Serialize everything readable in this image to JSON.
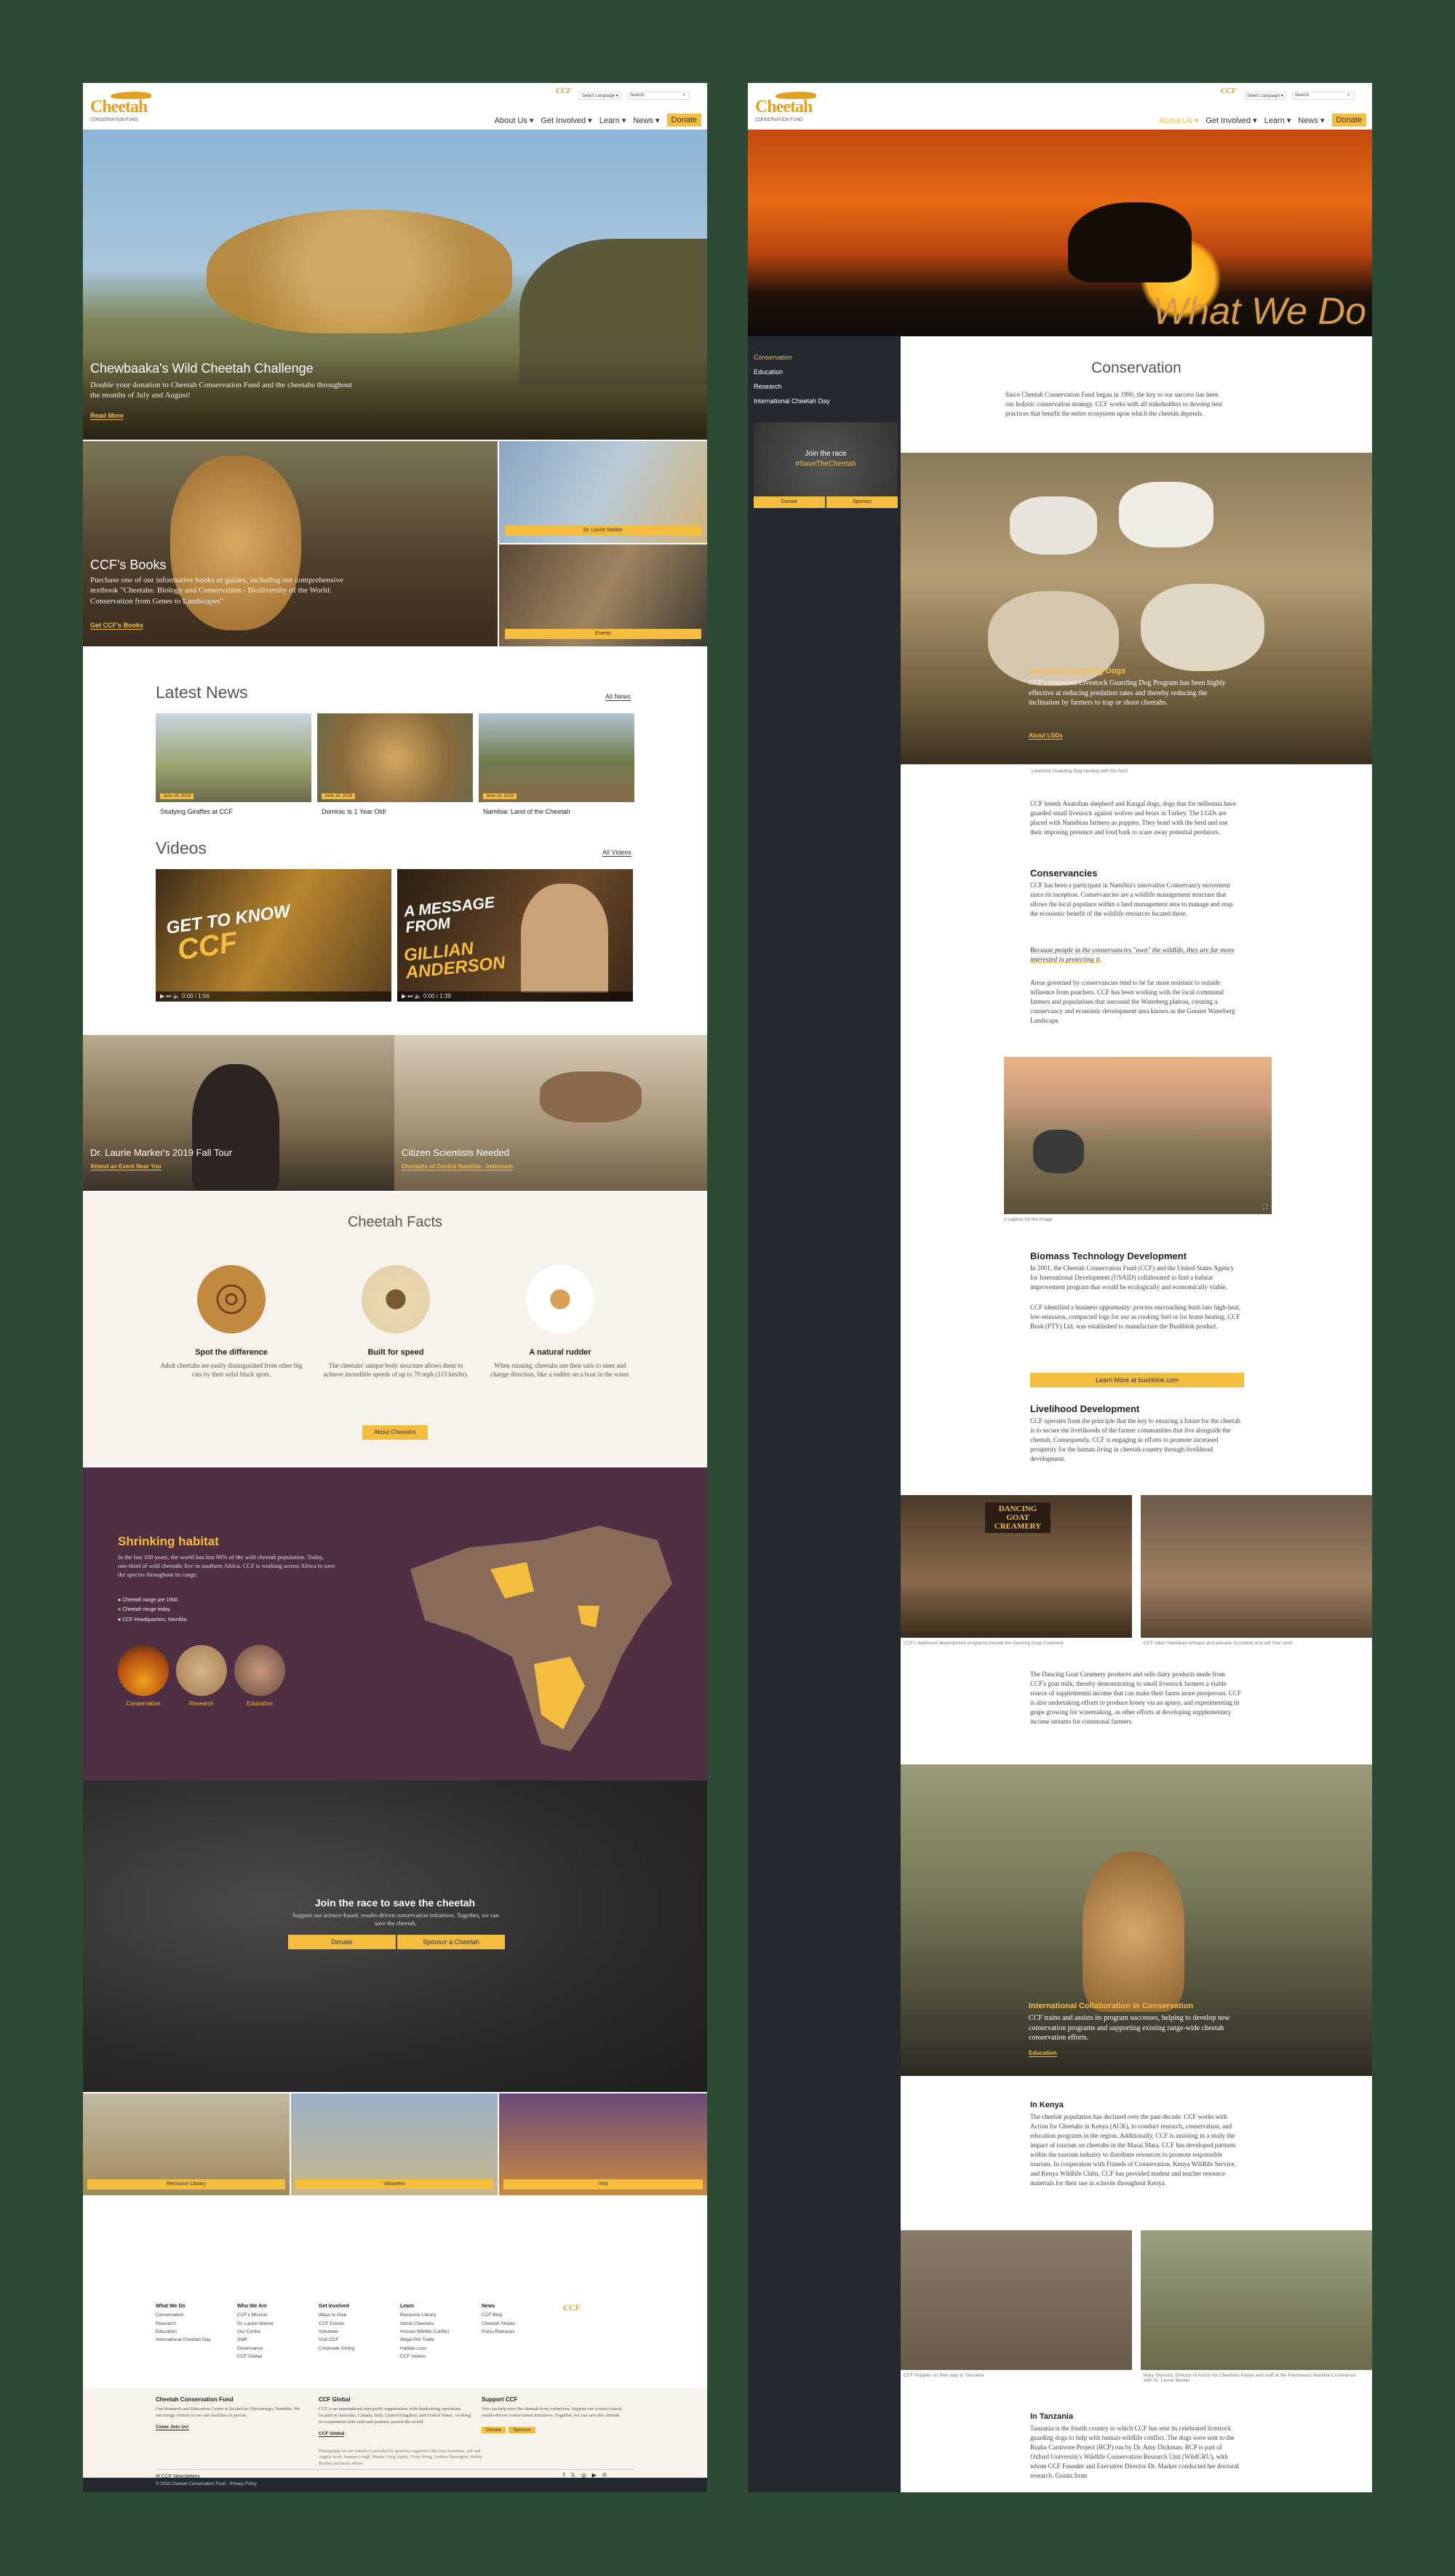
{
  "left": {
    "header": {
      "logo_text": "Cheetah",
      "logo_sub": "CONSERVATION FUND",
      "tiny_logo": "CCF",
      "language": "Select Language  ▾",
      "search_placeholder": "Search",
      "nav": [
        "About Us ▾",
        "Get Involved ▾",
        "Learn ▾",
        "News ▾"
      ],
      "donate": "Donate"
    },
    "hero": {
      "title": "Chewbaaka's Wild Cheetah Challenge",
      "text": "Double your donation to Cheetah Conservation Fund and the cheetahs throughout the months of July and August!",
      "link": "Read More"
    },
    "books": {
      "title": "CCF's Books",
      "text": "Purchase one of our informative books or guides, including our comprehensive textbook \"Cheetahs: Biology and Conservation - Biodiversity of the World: Conservation from Genes to Landscapes\"",
      "link": "Get CCF's Books"
    },
    "side_tiles": [
      "Dr. Laurie Marker",
      "Events"
    ],
    "latest_news": {
      "heading": "Latest News",
      "all": "All News",
      "items": [
        {
          "date": "June 19, 2019",
          "title": "Studying Giraffes at CCF"
        },
        {
          "date": "June 18, 2019",
          "title": "Dominic Is 1 Year Old!"
        },
        {
          "date": "June 14, 2019",
          "title": "Namibia: Land of the Cheetah"
        }
      ]
    },
    "videos": {
      "heading": "Videos",
      "all": "All Videos",
      "items": [
        {
          "overlay1": "GET TO KNOW",
          "overlay2": "CCF",
          "time": "0:00 / 1:56"
        },
        {
          "overlay1": "A MESSAGE FROM",
          "overlay2": "GILLIAN ANDERSON",
          "time": "0:00 / 1:39"
        }
      ]
    },
    "promos": [
      {
        "title": "Dr. Laurie Marker's 2019 Fall Tour",
        "link": "Attend an Event Near You"
      },
      {
        "title": "Citizen Scientists Needed",
        "link": "Cheetahs of Central Namibia - Indexcam"
      }
    ],
    "facts": {
      "heading": "Cheetah Facts",
      "items": [
        {
          "title": "Spot the difference",
          "text": "Adult cheetahs are easily distinguished from other big cats by their solid black spots."
        },
        {
          "title": "Built for speed",
          "text": "The cheetahs' unique body structure allows them to achieve incredible speeds of up to 70 mph (113 km/hr)."
        },
        {
          "title": "A natural rudder",
          "text": "When running, cheetahs use their tails to steer and change direction, like a rudder on a boat in the water."
        }
      ],
      "button": "About Cheetahs"
    },
    "habitat": {
      "title": "Shrinking habitat",
      "text": "In the last 100 years, the world has lost 90% of the wild cheetah population. Today, one-third of wild cheetahs live in southern Africa. CCF is working across Africa to save the species throughout its range.",
      "legend": [
        "Cheetah range pre 1900",
        "Cheetah range today",
        "CCF Headquarters, Namibia"
      ],
      "circles": [
        "Conservation",
        "Research",
        "Education"
      ]
    },
    "join": {
      "title": "Join the race to save the cheetah",
      "text": "Support our science-based, results-driven conservation initiatives. Together, we can save the cheetah.",
      "buttons": [
        "Donate",
        "Sponsor a Cheetah"
      ]
    },
    "tiles": [
      "Resource Library",
      "Volunteer",
      "Visit"
    ],
    "footer": {
      "cols": [
        {
          "head": "What We Do",
          "items": [
            "Conservation",
            "Research",
            "Education",
            "International Cheetah Day"
          ]
        },
        {
          "head": "Who We Are",
          "items": [
            "CCF's Mission",
            "Dr. Laurie Marker",
            "Our Centre",
            "Staff",
            "Governance",
            "CCF Global"
          ]
        },
        {
          "head": "Get Involved",
          "items": [
            "Ways to Give",
            "CCF Events",
            "Volunteer",
            "Visit CCF",
            "Corporate Giving"
          ]
        },
        {
          "head": "Learn",
          "items": [
            "Resource Library",
            "About Cheetahs",
            "Human Wildlife Conflict",
            "Illegal Pet Trade",
            "Habitat Loss",
            "CCF Videos"
          ]
        },
        {
          "head": "News",
          "items": [
            "CCF Blog",
            "Cheetah Strides",
            "Press Releases"
          ]
        }
      ],
      "blocks": [
        {
          "head": "Cheetah Conservation Fund",
          "text": "Our Research and Education Centre is located in Otjiwarongo, Namibia. We encourage visitors to see our facilities in person.",
          "link": "Come Join Us!"
        },
        {
          "head": "CCF Global",
          "text": "CCF is an international non-profit organization with fundraising operations located in Australia, Canada, Italy, United Kingdom, and United States, working in cooperation with staff and partners around the world.",
          "link": "CCF Global"
        },
        {
          "head": "Support CCF",
          "text": "You can help save the cheetah from extinction. Support our science-based, results-driven conservation initiatives. Together, we can save the cheetah.",
          "btns": [
            "Donate",
            "Sponsor"
          ]
        }
      ],
      "credits": "Photography on our website is provided by generous supporters like Suzi Eszterhas, Jeff and Angela Scott, Jasmine Lough, Marnie Craig Sapiro, Vicky Wong, Andrew Harrington, Bobby Bradley and many others.",
      "newsletter": "CCF Newsletters",
      "social": [
        "f",
        "𝕏",
        "◎",
        "▶",
        "℗"
      ],
      "copyright": "© 2019 Cheetah Conservation Fund  ·  Privacy Policy"
    }
  },
  "right": {
    "header": {
      "nav": [
        "About Us ▾",
        "Get Involved ▾",
        "Learn ▾",
        "News ▾"
      ],
      "donate": "Donate"
    },
    "hero_title": "What We Do",
    "sidebar": {
      "items": [
        "Conservation",
        "Education",
        "Research",
        "International Cheetah Day"
      ],
      "ad_line1": "Join the race",
      "ad_line2": "#SaveTheCheetah",
      "ad_btns": [
        "Donate",
        "Sponsor"
      ]
    },
    "content": {
      "heading": "Conservation",
      "intro": "Since Cheetah Conservation Fund began in 1990, the key to our success has been our holistic conservation strategy. CCF works with all stakeholders to develop best practices that benefit the entire ecosystem upon which the cheetah depends.",
      "lgd": {
        "title": "Livestock Guarding Dogs",
        "text": "CCF's renowned Livestock Guarding Dog Program has been highly effective at reducing predation rates and thereby reducing the inclination by farmers to trap or shoot cheetahs.",
        "link": "About LGDs",
        "caption": "Livestock Guarding Dog herding with the herd"
      },
      "lgd_text": "CCF breeds Anatolian shepherd and Kangal dogs, dogs that for millennia have guarded small livestock against wolves and bears in Turkey. The LGDs are placed with Namibian farmers as puppies. They bond with the herd and use their imposing presence and loud bark to scare away potential predators.",
      "conservancies": {
        "title": "Conservancies",
        "text": "CCF has been a participant in Namibia's innovative Conservancy movement since its inception. Conservancies are a wildlife management structure that allows the local populace within a land management area to manage and reap the economic benefit of the wildlife resources located there.",
        "quote": "Because people in the conservancies \"own\" the wildlife, they are far more interested in protecting it.",
        "text2": "Areas governed by conservancies tend to be far more resistant to outside influence from poachers. CCF has been working with the local communal farmers and populations that surround the Waterberg plateau, creating a conservancy and economic development area known as the Greater Waterberg Landscape."
      },
      "img_caption": "A caption for the image.",
      "biomass": {
        "title": "Biomass Technology Development",
        "text1": "In 2001, the Cheetah Conservation Fund (CCF) and the United States Agency for International Development (USAID) collaborated to find a habitat improvement program that would be ecologically and economically viable.",
        "text2": "CCF identified a business opportunity: process encroaching bush into high-heat, low-emission, compacted logs for use as cooking fuel or for home heating. CCF Bush (PTY) Ltd. was established to manufacture the Bushblok product.",
        "button": "Learn More at bushblok.com"
      },
      "livelihood": {
        "title": "Livelihood Development",
        "text": "CCF operates from the principle that the key to ensuring a future for the cheetah is to secure the livelihoods of the farmer communities that live alongside the cheetah. Consequently, CCF is engaging in efforts to promote increased prosperity for the human living in cheetah-country through livelihood development."
      },
      "photo_captions": [
        "CCF's livelihood development programs include the Dancing Goat Creamery",
        "CCF takes Namibian artisans and artisans to market and sell their work"
      ],
      "creamery_sign": "DANCING GOAT CREAMERY",
      "creamery": "The Dancing Goat Creamery produces and sells dairy products made from CCF's goat milk, thereby demonstrating to small livestock farmers a viable source of supplemental income that can make their farms more prosperous. CCF is also undertaking efforts to produce honey via an apiary, and experimenting in grape growing for winemaking, as other efforts at developing supplementary income streams for communal farmers.",
      "intl": {
        "title": "International Collaboration in Conservation",
        "text": "CCF trains and assists its program successes, helping to develop new conservation programs and supporting existing range-wide cheetah conservation efforts.",
        "link": "Education"
      },
      "kenya": {
        "title": "In Kenya",
        "text": "The cheetah population has declined over the past decade. CCF works with Action for Cheetahs in Kenya (ACK), to conduct research, conservation, and education programs in the region. Additionally, CCF is assisting in a study the impact of tourism on cheetahs in the Masai Mara. CCF has developed partners within the tourism industry to distribute resources to promote responsible tourism. In cooperation with Friends of Conservation, Kenya Wildlife Service, and Kenya Wildlife Clubs, CCF has provided student and teacher resource materials for their use in schools throughout Kenya."
      },
      "kenya_captions": [
        "CCF Puppies on their way to Tanzania",
        "Mary Wykstra, Director of Action for Cheetahs Kenya and staff at the Pamnwaza Namibia Conference with Dr. Laurie Marker"
      ],
      "tanzania": {
        "title": "In Tanzania",
        "text": "Tanzania is the fourth country to which CCF has sent its celebrated livestock guarding dogs to help with human-wildlife conflict. The dogs were sent to the Ruaha Carnivore Project (RCP) run by Dr. Amy Dickman. RCP is part of Oxford University's Wildlife Conservation Research Unit (WildCRU), with whom CCF Founder and Executive Director Dr. Marker conducted her doctoral research. Grants from"
      }
    }
  }
}
